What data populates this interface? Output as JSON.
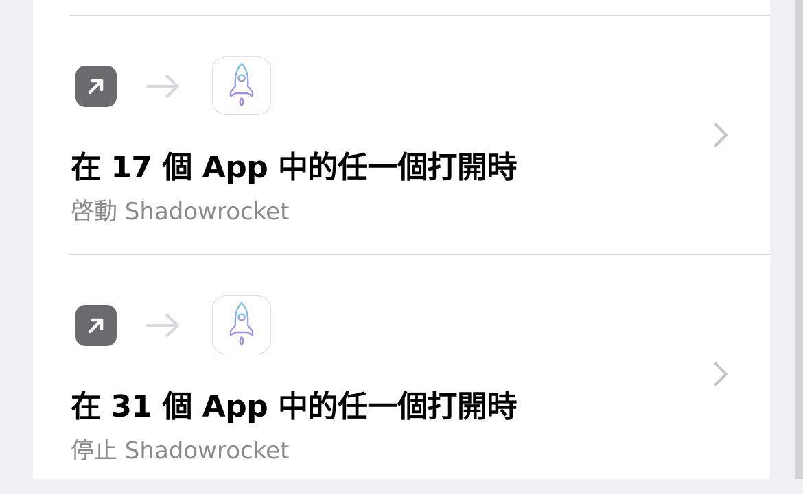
{
  "colors": {
    "background": "#efeff4",
    "card": "#ffffff",
    "open_app_icon_bg": "#6a6a6f",
    "title": "#000000",
    "subtitle": "#8a8a8e",
    "chevron": "#c4c4c8",
    "flow_arrow": "#d9d9dd",
    "rocket_gradient_top": "#7cc9ee",
    "rocket_gradient_bottom": "#a58ae0"
  },
  "automations": [
    {
      "title": "在 17 個 App 中的任一個打開時",
      "subtitle": "啓動 Shadowrocket",
      "trigger_icon": "open-app-icon",
      "action_app_icon": "shadowrocket-rocket-icon"
    },
    {
      "title": "在 31 個 App 中的任一個打開時",
      "subtitle": "停止 Shadowrocket",
      "trigger_icon": "open-app-icon",
      "action_app_icon": "shadowrocket-rocket-icon"
    }
  ]
}
